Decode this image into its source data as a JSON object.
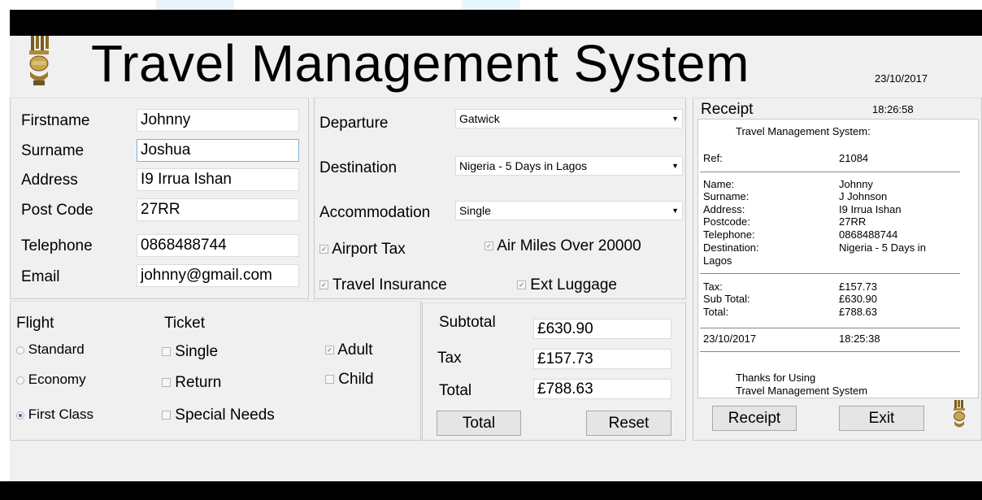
{
  "app": {
    "title": "Travel Management System",
    "date": "23/10/2017"
  },
  "customer": {
    "firstname_label": "Firstname",
    "firstname_value": "Johnny",
    "surname_label": "Surname",
    "surname_value": "Joshua",
    "address_label": "Address",
    "address_value": "I9 Irrua Ishan",
    "postcode_label": "Post Code",
    "postcode_value": "27RR",
    "telephone_label": "Telephone",
    "telephone_value": "0868488744",
    "email_label": "Email",
    "email_value": "johnny@gmail.com"
  },
  "trip": {
    "departure_label": "Departure",
    "departure_value": "Gatwick",
    "destination_label": "Destination",
    "destination_value": "Nigeria - 5 Days in Lagos",
    "accommodation_label": "Accommodation",
    "accommodation_value": "Single",
    "airport_tax_label": "Airport Tax",
    "airport_tax_checked": true,
    "air_miles_label": "Air Miles Over 20000",
    "air_miles_checked": true,
    "travel_insurance_label": "Travel Insurance",
    "travel_insurance_checked": true,
    "ext_luggage_label": "Ext Luggage",
    "ext_luggage_checked": true
  },
  "flight": {
    "header": "Flight",
    "options": [
      "Standard",
      "Economy",
      "First Class"
    ],
    "selected": "First Class"
  },
  "ticket": {
    "header": "Ticket",
    "single_label": "Single",
    "return_label": "Return",
    "special_needs_label": "Special Needs",
    "adult_label": "Adult",
    "adult_checked": true,
    "child_label": "Child"
  },
  "totals": {
    "subtotal_label": "Subtotal",
    "subtotal_value": "£630.90",
    "tax_label": "Tax",
    "tax_value": "£157.73",
    "total_label": "Total",
    "total_value": "£788.63",
    "total_button": "Total",
    "reset_button": "Reset"
  },
  "receipt": {
    "header": "Receipt",
    "time": "18:26:58",
    "heading": "Travel Management System:",
    "ref_label": "Ref:",
    "ref_value": "21084",
    "name_label": "Name:",
    "name_value": "Johnny",
    "surname_label": "Surname:",
    "surname_value": "J Johnson",
    "address_label": "Address:",
    "address_value": "I9 Irrua Ishan",
    "postcode_label": "Postcode:",
    "postcode_value": "27RR",
    "telephone_label": "Telephone:",
    "telephone_value": "0868488744",
    "destination_label": "Destination:",
    "destination_value": "Nigeria - 5 Days in",
    "destination_overflow": "Lagos",
    "tax_label": "Tax:",
    "tax_value": "£157.73",
    "subtotal_label": "Sub Total:",
    "subtotal_value": "£630.90",
    "total_label": "Total:",
    "total_value": "£788.63",
    "date": "23/10/2017",
    "time_stamp": "18:25:38",
    "thanks_line1": "Thanks for Using",
    "thanks_line2": "Travel Management System",
    "receipt_button": "Receipt",
    "exit_button": "Exit"
  },
  "icons": {
    "logo": "army-crest-logo",
    "check": "check-icon",
    "dropdown": "chevron-down-icon"
  }
}
